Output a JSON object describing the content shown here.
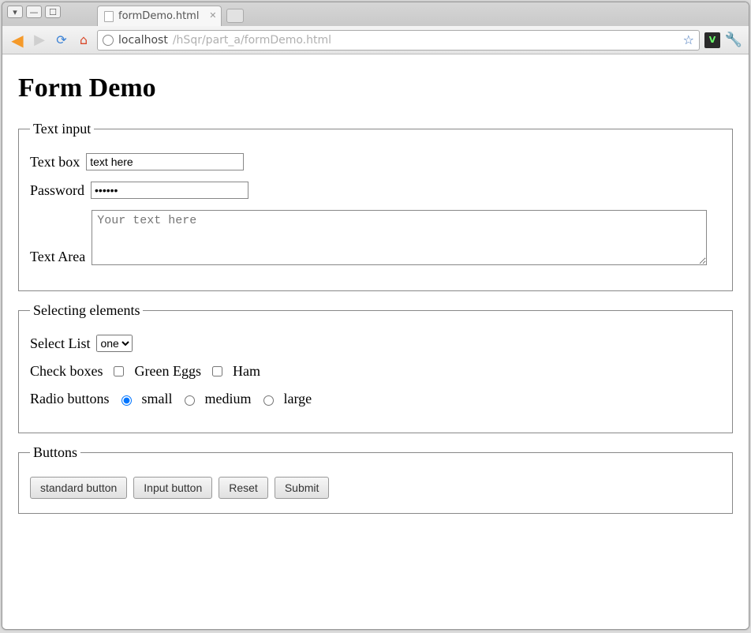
{
  "window": {
    "tab_title": "formDemo.html"
  },
  "urlbar": {
    "host": "localhost",
    "path": "/hSqr/part_a/formDemo.html"
  },
  "page": {
    "title": "Form Demo"
  },
  "fieldsets": {
    "text_input_legend": "Text input",
    "selecting_legend": "Selecting elements",
    "buttons_legend": "Buttons"
  },
  "text_input": {
    "textbox_label": "Text box",
    "textbox_value": "text here",
    "password_label": "Password",
    "password_value": "••••••",
    "textarea_label": "Text Area",
    "textarea_placeholder": "Your text here"
  },
  "selecting": {
    "select_label": "Select List",
    "select_value": "one",
    "checkboxes_label": "Check boxes",
    "checkbox1_label": "Green Eggs",
    "checkbox2_label": "Ham",
    "radios_label": "Radio buttons",
    "radio1_label": "small",
    "radio2_label": "medium",
    "radio3_label": "large",
    "radio_selected": "small"
  },
  "buttons": {
    "standard": "standard button",
    "input": "Input button",
    "reset": "Reset",
    "submit": "Submit"
  }
}
